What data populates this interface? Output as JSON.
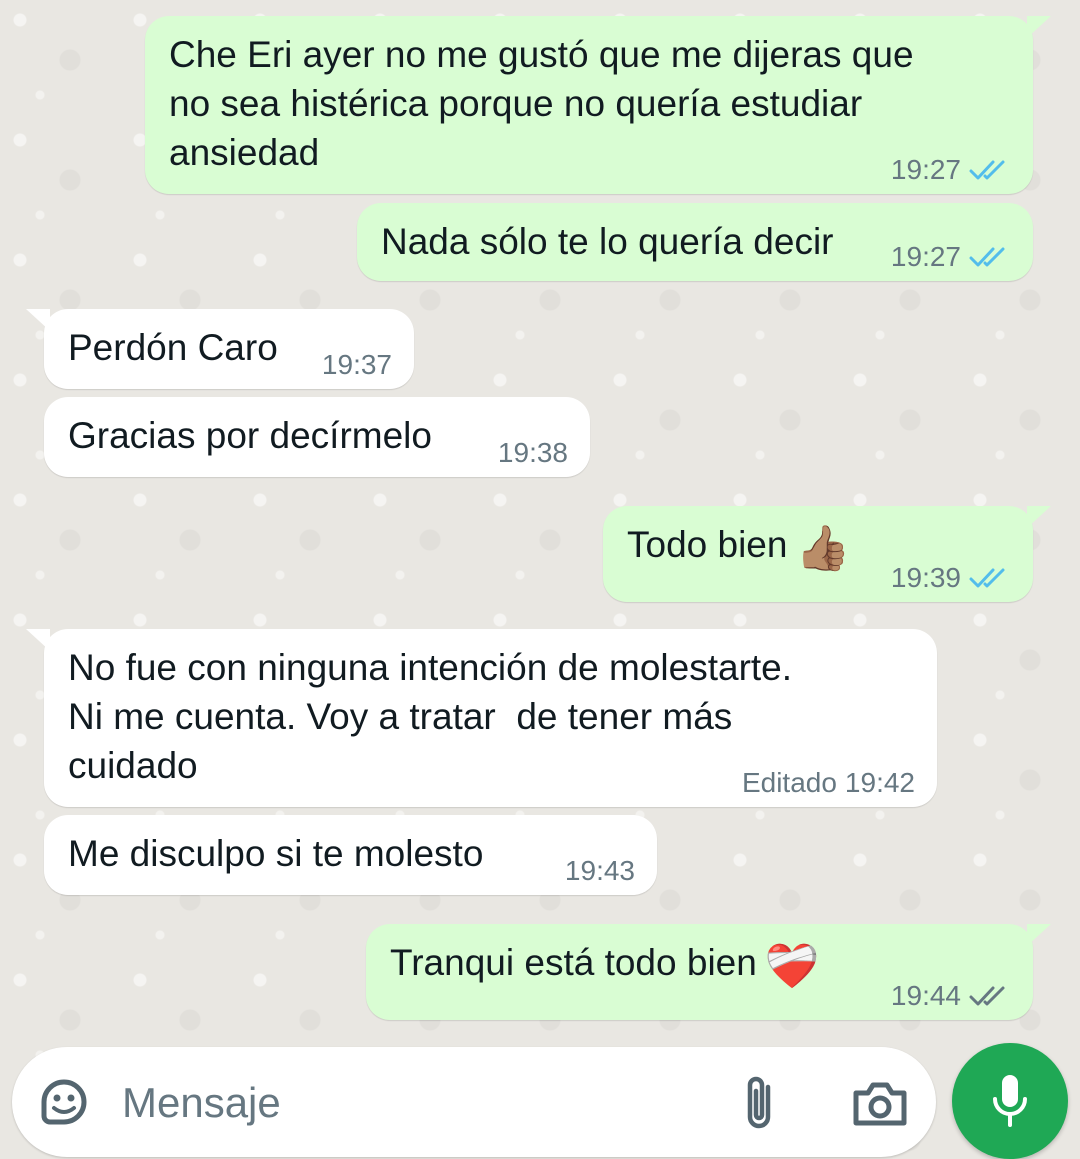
{
  "theme": {
    "sent_bubble": "#d9fdd3",
    "received_bubble": "#ffffff",
    "read_check": "#53bdeb",
    "delivered_check": "#667781",
    "mic_button": "#1fa855"
  },
  "messages": [
    {
      "direction": "sent",
      "text": "Che Eri ayer no me gustó que me dijeras que\nno sea histérica porque no quería estudiar\nansiedad",
      "time": "19:27",
      "status": "read"
    },
    {
      "direction": "sent",
      "text": "Nada sólo te lo quería decir",
      "time": "19:27",
      "status": "read"
    },
    {
      "direction": "received",
      "text": "Perdón Caro",
      "time": "19:37"
    },
    {
      "direction": "received",
      "text": "Gracias por decírmelo",
      "time": "19:38"
    },
    {
      "direction": "sent",
      "text": "Todo bien",
      "emoji": "👍🏽",
      "time": "19:39",
      "status": "read"
    },
    {
      "direction": "received",
      "text": "No fue con ninguna intención de molestarte.\nNi me cuenta. Voy a tratar  de tener más\ncuidado",
      "edited_label": "Editado",
      "time": "19:42"
    },
    {
      "direction": "received",
      "text": "Me disculpo si te molesto",
      "time": "19:43"
    },
    {
      "direction": "sent",
      "text": "Tranqui está todo bien",
      "emoji": "❤️‍🩹",
      "time": "19:44",
      "status": "delivered"
    }
  ],
  "composer": {
    "placeholder": "Mensaje",
    "icons": [
      "sticker-icon",
      "attach-icon",
      "camera-icon",
      "mic-icon"
    ]
  }
}
